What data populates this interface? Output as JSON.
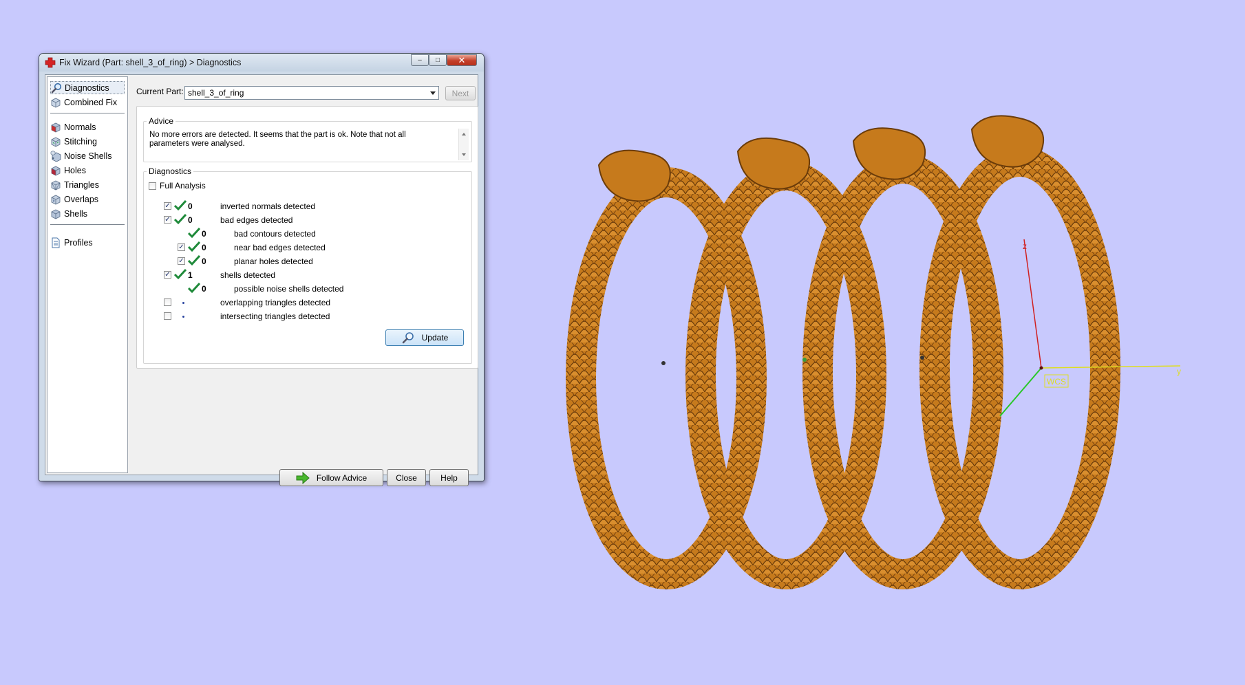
{
  "window": {
    "title": "Fix Wizard (Part: shell_3_of_ring) > Diagnostics",
    "minimize": "–",
    "maximize": "□",
    "close": "✕"
  },
  "sidebar": {
    "items": [
      {
        "label": "Diagnostics",
        "icon": "magnifier-icon"
      },
      {
        "label": "Combined Fix",
        "icon": "cube-icon"
      },
      {
        "label": "Normals",
        "icon": "normals-cube-icon"
      },
      {
        "label": "Stitching",
        "icon": "stitching-cube-icon"
      },
      {
        "label": "Noise Shells",
        "icon": "noise-shells-icon"
      },
      {
        "label": "Holes",
        "icon": "holes-cube-icon"
      },
      {
        "label": "Triangles",
        "icon": "triangles-cube-icon"
      },
      {
        "label": "Overlaps",
        "icon": "overlaps-cube-icon"
      },
      {
        "label": "Shells",
        "icon": "shells-cube-icon"
      },
      {
        "label": "Profiles",
        "icon": "document-icon"
      }
    ]
  },
  "main": {
    "current_part_label": "Current Part:",
    "current_part_value": "shell_3_of_ring",
    "next_label": "Next",
    "advice": {
      "title": "Advice",
      "text": "No more errors are detected. It seems that the part is ok. Note that not all parameters were analysed."
    },
    "diagnostics": {
      "title": "Diagnostics",
      "full_analysis_label": "Full Analysis",
      "rows": [
        {
          "checked": true,
          "status": "ok",
          "count": "0",
          "label": "inverted normals detected",
          "indent": 0
        },
        {
          "checked": true,
          "status": "ok",
          "count": "0",
          "label": "bad edges detected",
          "indent": 0
        },
        {
          "checked": null,
          "status": "ok",
          "count": "0",
          "label": "bad contours detected",
          "indent": 1
        },
        {
          "checked": true,
          "status": "ok",
          "count": "0",
          "label": "near bad edges detected",
          "indent": 1
        },
        {
          "checked": true,
          "status": "ok",
          "count": "0",
          "label": "planar holes detected",
          "indent": 1
        },
        {
          "checked": true,
          "status": "ok",
          "count": "1",
          "label": "shells detected",
          "indent": 0
        },
        {
          "checked": null,
          "status": "ok",
          "count": "0",
          "label": "possible noise shells detected",
          "indent": 1
        },
        {
          "checked": false,
          "status": "none",
          "count": "",
          "label": "overlapping triangles detected",
          "indent": 0
        },
        {
          "checked": false,
          "status": "none",
          "count": "",
          "label": "intersecting triangles detected",
          "indent": 0
        }
      ],
      "update_label": "Update"
    },
    "buttons": {
      "follow_advice": "Follow Advice",
      "close": "Close",
      "help": "Help"
    }
  },
  "viewport": {
    "axis_z": "z",
    "axis_y": "y",
    "wcs_label": "WCS",
    "model_color": "#c67a1c",
    "background": "#c8c9fd"
  }
}
